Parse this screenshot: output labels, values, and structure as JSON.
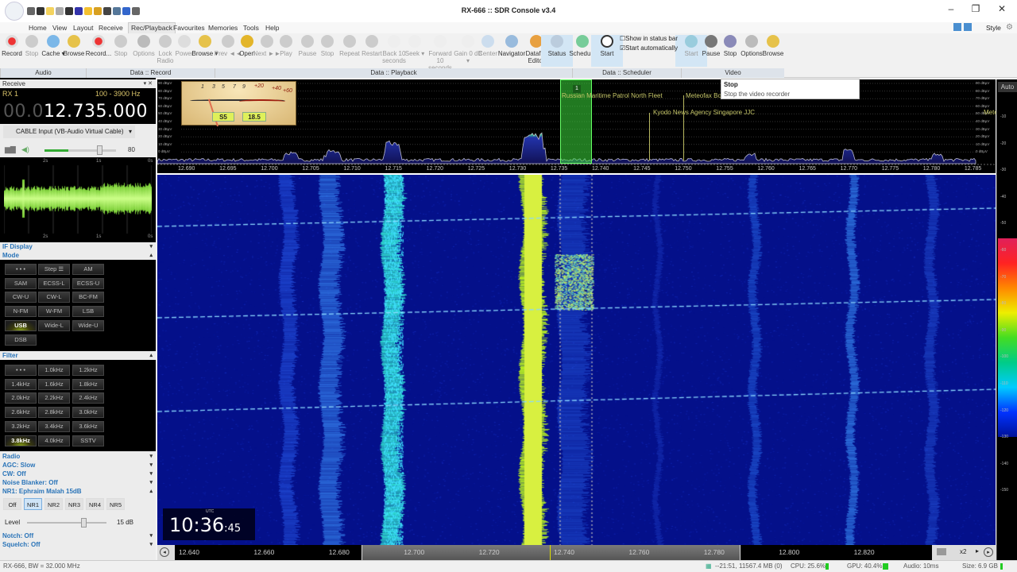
{
  "window": {
    "title": "RX-666 :: SDR Console v3.4",
    "minimize": "–",
    "restore": "❐",
    "close": "✕"
  },
  "quick_access": [
    "home-icon",
    "users-icon",
    "folder-icon",
    "play-icon",
    "record-icon",
    "stop-icon",
    "favourite-icon",
    "lock-icon",
    "camera-icon",
    "person-icon",
    "undo-icon",
    "more-icon"
  ],
  "menu": {
    "tabs": [
      "Home",
      "View",
      "Layout",
      "Receive",
      "Rec/Playback",
      "Favourites",
      "Memories",
      "Tools",
      "Help"
    ],
    "active": "Rec/Playback",
    "style": "Style"
  },
  "ribbon": {
    "groups": [
      "Audio",
      "Data :: Record",
      "Data :: Playback",
      "Data :: Scheduler",
      "Video"
    ],
    "buttons": [
      {
        "label": "Record",
        "icon": "record-icon",
        "state": "enabled"
      },
      {
        "label": "Stop",
        "icon": "stop-icon",
        "state": "disabled"
      },
      {
        "label": "Cache ▾",
        "icon": "clock-icon",
        "state": "enabled"
      },
      {
        "label": "Browse",
        "icon": "folder-icon",
        "state": "enabled"
      },
      {
        "label": "Record...",
        "icon": "record-icon",
        "state": "enabled"
      },
      {
        "label": "Stop",
        "icon": "stop-icon",
        "state": "disabled"
      },
      {
        "label": "Options",
        "icon": "gear-icon",
        "state": "disabled"
      },
      {
        "label": "Lock Radio",
        "icon": "lock-icon",
        "state": "disabled"
      },
      {
        "label": "Power",
        "icon": "power-icon",
        "state": "disabled"
      },
      {
        "label": "Browse ▾",
        "icon": "folder-icon",
        "state": "enabled"
      },
      {
        "label": "Prev ◄◄",
        "icon": "prev-icon",
        "state": "disabled"
      },
      {
        "label": "Open",
        "icon": "open-folder-icon",
        "state": "enabled"
      },
      {
        "label": "Next ►►",
        "icon": "next-icon",
        "state": "disabled"
      },
      {
        "label": "Play",
        "icon": "play-icon",
        "state": "disabled"
      },
      {
        "label": "Pause",
        "icon": "pause-icon",
        "state": "disabled"
      },
      {
        "label": "Stop",
        "icon": "stop-icon",
        "state": "disabled"
      },
      {
        "label": "Repeat",
        "icon": "repeat-icon",
        "state": "disabled"
      },
      {
        "label": "Restart",
        "icon": "restart-icon",
        "state": "disabled"
      },
      {
        "label": "Back 10 seconds",
        "icon": "back-icon",
        "state": "disabled"
      },
      {
        "label": "Seek ▾",
        "icon": "seek-icon",
        "state": "disabled"
      },
      {
        "label": "Forward 10 seconds",
        "icon": "forward-icon",
        "state": "disabled"
      },
      {
        "label": "Gain 0 dB ▾",
        "icon": "plus-minus-icon",
        "state": "disabled"
      },
      {
        "label": "Center",
        "icon": "printer-icon",
        "state": "disabled"
      },
      {
        "label": "Navigator",
        "icon": "search-icon",
        "state": "enabled"
      },
      {
        "label": "Datafile Editor",
        "icon": "pencil-icon",
        "state": "enabled"
      },
      {
        "label": "Status",
        "icon": "list-icon",
        "state": "active"
      },
      {
        "label": "Schedule",
        "icon": "calendar-icon",
        "state": "enabled"
      },
      {
        "label": "Start",
        "icon": "play-circle-icon",
        "state": "active"
      },
      {
        "label": "Start",
        "icon": "video-icon",
        "state": "active-disabled"
      },
      {
        "label": "Pause",
        "icon": "pause-icon",
        "state": "enabled"
      },
      {
        "label": "Stop",
        "icon": "stop-icon",
        "state": "hover"
      },
      {
        "label": "Options",
        "icon": "gear-icon",
        "state": "enabled"
      },
      {
        "label": "Browse",
        "icon": "folder-icon",
        "state": "enabled"
      }
    ],
    "checkboxes": [
      {
        "label": "Show in status bar",
        "checked": false
      },
      {
        "label": "Start automatically",
        "checked": true
      }
    ]
  },
  "tooltip": {
    "title": "Stop",
    "text": "Stop the video recorder"
  },
  "receive": {
    "title": "Receive",
    "rx": "RX 1",
    "bandwidth": "100 - 3900 Hz",
    "freq_dim": "00.0",
    "freq": "12.735.000",
    "input": "CABLE Input (VB-Audio Virtual Cable)",
    "volume": "80",
    "volume_level": 80,
    "scope_labels": [
      "2s",
      "1s",
      "0s"
    ]
  },
  "sections": {
    "if_display": "IF Display",
    "mode": "Mode",
    "filter": "Filter",
    "radio": "Radio",
    "agc": "AGC: Slow",
    "cw": "CW: Off",
    "noise_blanker": "Noise Blanker: Off",
    "nr": "NR1: Ephraim Malah 15dB",
    "notch": "Notch: Off",
    "squelch": "Squelch: Off"
  },
  "modes": [
    "• • •",
    "Step ☰",
    "AM",
    "SAM",
    "ECSS-L",
    "ECSS-U",
    "CW-U",
    "CW-L",
    "BC-FM",
    "N-FM",
    "W-FM",
    "LSB",
    "USB",
    "Wide-L",
    "Wide-U",
    "DSB"
  ],
  "mode_selected": "USB",
  "filters": [
    "• • •",
    "1.0kHz",
    "1.2kHz",
    "1.4kHz",
    "1.6kHz",
    "1.8kHz",
    "2.0kHz",
    "2.2kHz",
    "2.4kHz",
    "2.6kHz",
    "2.8kHz",
    "3.0kHz",
    "3.2kHz",
    "3.4kHz",
    "3.6kHz",
    "3.8kHz",
    "4.0kHz",
    "SSTV"
  ],
  "filter_selected": "3.8kHz",
  "nr": {
    "buttons": [
      "Off",
      "NR1",
      "NR2",
      "NR3",
      "NR4",
      "NR5"
    ],
    "selected": "NR1",
    "level_label": "Level",
    "level": "15 dB",
    "level_fraction": 0.6
  },
  "smeter": {
    "scale": [
      "1",
      "3",
      "5",
      "7",
      "9",
      "+20",
      "+40",
      "+60"
    ],
    "s_value": "S5",
    "db_value": "18.5"
  },
  "spectrum": {
    "db_labels": [
      "90 dBµV",
      "80 dBµV",
      "70 dBµV",
      "60 dBµV",
      "50 dBµV",
      "40 dBµV",
      "30 dBµV",
      "20 dBµV",
      "10 dBµV",
      "0 dBµV"
    ],
    "freq_ticks": [
      "12.690",
      "12.695",
      "12.700",
      "12.705",
      "12.710",
      "12.715",
      "12.720",
      "12.725",
      "12.730",
      "12.735",
      "12.740",
      "12.745",
      "12.750",
      "12.755",
      "12.760",
      "12.765",
      "12.770",
      "12.775",
      "12.780",
      "12.785"
    ],
    "marker": "1",
    "bookmarks": [
      "Russian Maritime Patrol North Fleet",
      "Meteofax Bo",
      "Kyodo News Agency Singapore JJC",
      "Mete"
    ],
    "auto": "Auto"
  },
  "colorscale": [
    "-10",
    "-20",
    "-30",
    "-40",
    "-50",
    "-60",
    "-70",
    "-80",
    "-90",
    "-100",
    "-110",
    "-120",
    "-130",
    "-140",
    "-150"
  ],
  "clock": {
    "zone": "UTC",
    "hm": "10:36",
    "sec": ":45"
  },
  "bottom_scale": {
    "ticks": [
      "12.640",
      "12.660",
      "12.680",
      "12.700",
      "12.720",
      "12.740",
      "12.760",
      "12.780",
      "12.800",
      "12.820"
    ],
    "zoom": "x2"
  },
  "status": {
    "left": "RX-666, BW = 32.000 MHz",
    "time": "--21:51,",
    "memory": "11567.4 MB (0)",
    "cpu": "CPU: 25.6%",
    "gpu": "GPU: 40.4%",
    "audio": "Audio: 10ms",
    "size": "Size: 6.9 GB"
  }
}
